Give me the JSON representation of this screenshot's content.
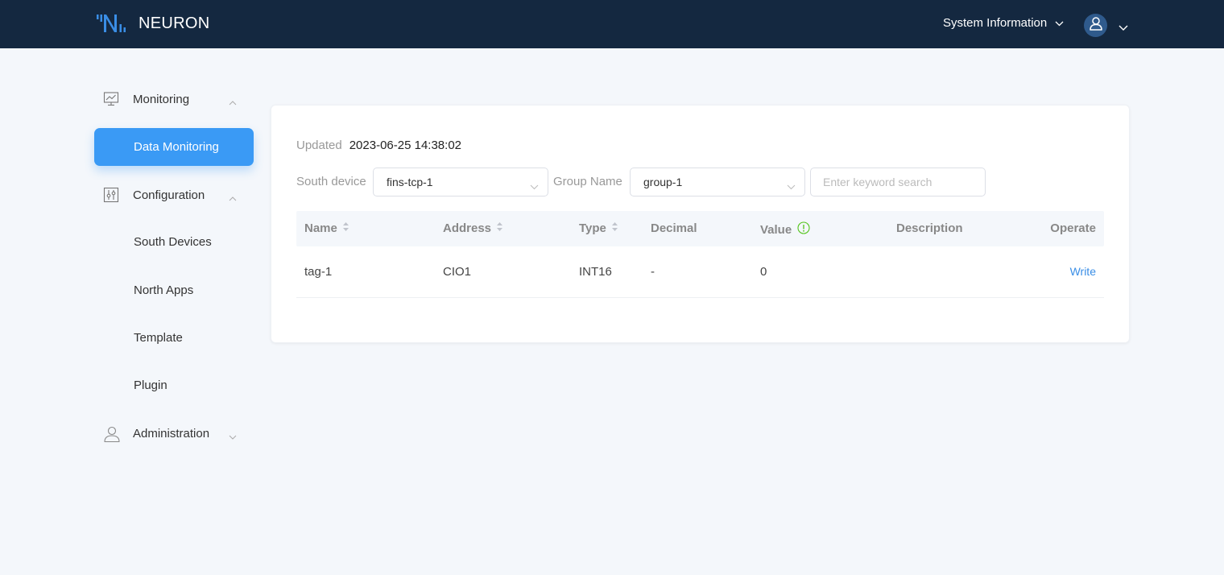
{
  "header": {
    "app_name": "NEURON",
    "system_info_label": "System Information",
    "user_icon": "user-icon"
  },
  "sidebar": {
    "groups": [
      {
        "label": "Monitoring",
        "icon": "monitor-chart-icon",
        "expanded": true,
        "items": [
          {
            "label": "Data Monitoring",
            "active": true
          }
        ]
      },
      {
        "label": "Configuration",
        "icon": "sliders-icon",
        "expanded": true,
        "items": [
          {
            "label": "South Devices"
          },
          {
            "label": "North Apps"
          },
          {
            "label": "Template"
          },
          {
            "label": "Plugin"
          }
        ]
      },
      {
        "label": "Administration",
        "icon": "user-icon",
        "expanded": false,
        "items": []
      }
    ]
  },
  "main": {
    "updated_label": "Updated",
    "updated_value": "2023-06-25 14:38:02",
    "filters": {
      "south_device_label": "South device",
      "south_device_value": "fins-tcp-1",
      "group_name_label": "Group Name",
      "group_name_value": "group-1",
      "search_placeholder": "Enter keyword search",
      "search_value": ""
    },
    "table": {
      "columns": [
        "Name",
        "Address",
        "Type",
        "Decimal",
        "Value",
        "Description",
        "Operate"
      ],
      "rows": [
        {
          "name": "tag-1",
          "address": "CIO1",
          "type": "INT16",
          "decimal": "-",
          "value": "0",
          "description": "",
          "operate": "Write"
        }
      ]
    },
    "colors": {
      "header_bg": "#142840",
      "accent": "#3a9af5",
      "link": "#3a8ee6",
      "info_icon": "#52c41a"
    }
  }
}
